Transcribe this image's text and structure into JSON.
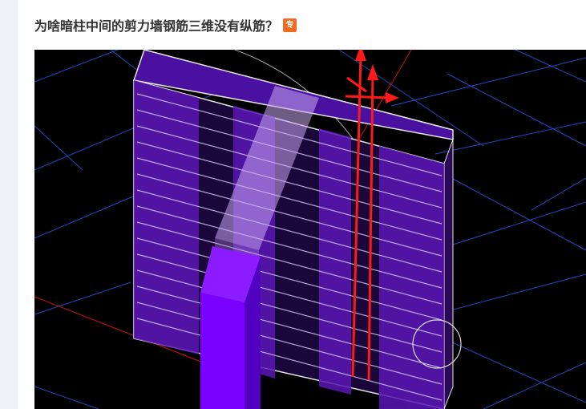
{
  "question": {
    "title": "为啥暗柱中间的剪力墙钢筋三维没有纵筋？",
    "badge_label": "专",
    "badge_color": "#f26a21"
  },
  "viewport": {
    "background": "#000000",
    "wall_color": "#6a1fcf",
    "column_color": "#7a00ff",
    "axis_color": "#ff1a1a",
    "grid_color": "#2a4fd8"
  }
}
